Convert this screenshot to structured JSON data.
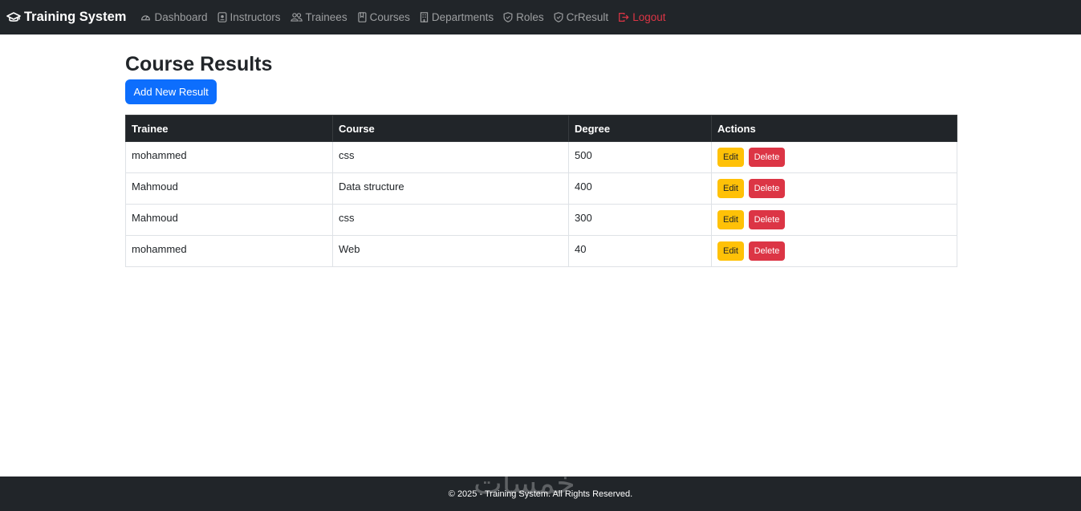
{
  "navbar": {
    "brand": "Training System",
    "items": [
      {
        "label": "Dashboard",
        "icon": "speedometer-icon"
      },
      {
        "label": "Instructors",
        "icon": "person-badge-icon"
      },
      {
        "label": "Trainees",
        "icon": "people-icon"
      },
      {
        "label": "Courses",
        "icon": "journal-icon"
      },
      {
        "label": "Departments",
        "icon": "building-icon"
      },
      {
        "label": "Roles",
        "icon": "shield-icon"
      },
      {
        "label": "CrResult",
        "icon": "shield-icon"
      }
    ],
    "logout": "Logout",
    "colors": {
      "background": "#212529",
      "logout": "#dc3545"
    }
  },
  "main": {
    "title": "Course Results",
    "add_button": "Add New Result",
    "table": {
      "headers": [
        "Trainee",
        "Course",
        "Degree",
        "Actions"
      ],
      "rows": [
        {
          "trainee": "mohammed",
          "course": "css",
          "degree": "500"
        },
        {
          "trainee": "Mahmoud",
          "course": "Data structure",
          "degree": "400"
        },
        {
          "trainee": "Mahmoud",
          "course": "css",
          "degree": "300"
        },
        {
          "trainee": "mohammed",
          "course": "Web",
          "degree": "40"
        }
      ],
      "edit_label": "Edit",
      "delete_label": "Delete"
    },
    "colors": {
      "primary": "#0d6efd",
      "warning": "#ffc107",
      "danger": "#dc3545"
    }
  },
  "footer": {
    "text": "© 2025 - Training System. All Rights Reserved.",
    "watermark": "خمسات"
  }
}
